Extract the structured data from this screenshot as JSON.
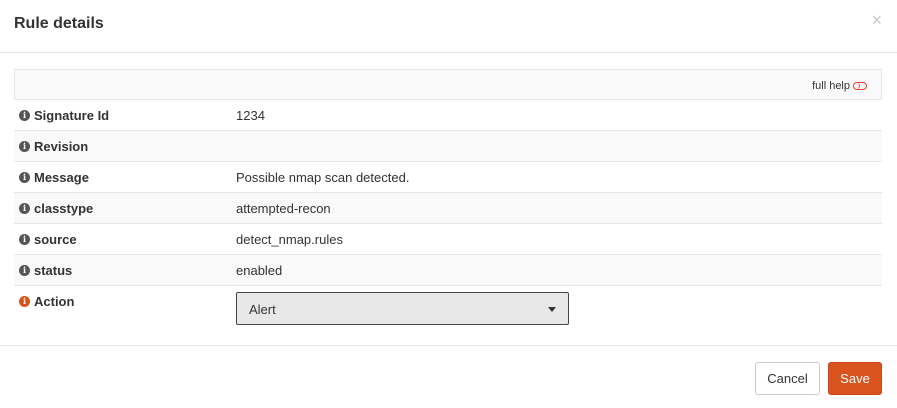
{
  "modal": {
    "title": "Rule details",
    "close_glyph": "×"
  },
  "help": {
    "label": "full help"
  },
  "fields": [
    {
      "label": "Signature Id",
      "value": "1234"
    },
    {
      "label": "Revision",
      "value": ""
    },
    {
      "label": "Message",
      "value": "Possible nmap scan detected."
    },
    {
      "label": "classtype",
      "value": "attempted-recon"
    },
    {
      "label": "source",
      "value": "detect_nmap.rules"
    },
    {
      "label": "status",
      "value": "enabled"
    }
  ],
  "action": {
    "label": "Action",
    "selected": "Alert"
  },
  "footer": {
    "cancel_label": "Cancel",
    "save_label": "Save"
  },
  "colors": {
    "accent": "#d9531e",
    "info_icon": "#555555",
    "row_alt": "#f9f9f9"
  },
  "icons": {
    "info": "info-circle-icon",
    "toggle": "toggle-off-icon",
    "close": "close-icon",
    "caret": "caret-down-icon"
  }
}
